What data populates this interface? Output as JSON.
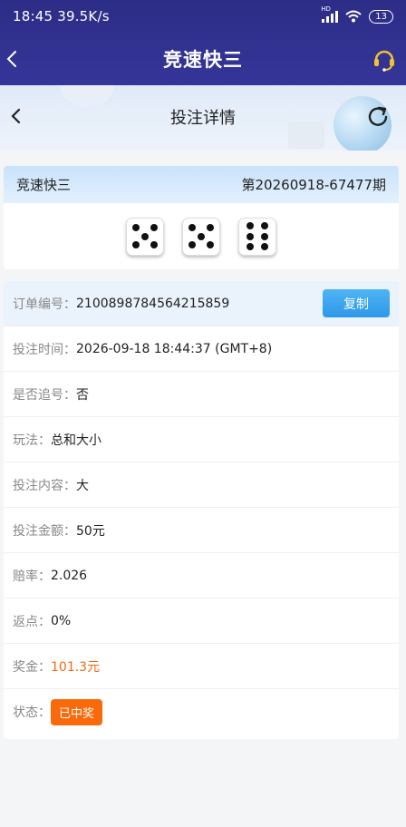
{
  "status_bar": {
    "time": "18:45",
    "speed": "39.5K/s",
    "network": "HD",
    "battery": "13"
  },
  "nav": {
    "title": "竞速快三",
    "back_icon": "chevron-left-icon",
    "service_icon": "headset-icon"
  },
  "sub_header": {
    "title": "投注详情",
    "back_icon": "chevron-left-icon",
    "refresh_icon": "refresh-icon"
  },
  "game": {
    "name": "竞速快三",
    "issue": "第20260918-67477期",
    "dice": [
      5,
      5,
      6
    ]
  },
  "details": {
    "order_label": "订单编号：",
    "order_value": "2100898784564215859",
    "copy_label": "复制",
    "time_label": "投注时间：",
    "time_value": "2026-09-18 18:44:37 (GMT+8)",
    "chase_label": "是否追号：",
    "chase_value": "否",
    "play_label": "玩法：",
    "play_value": "总和大小",
    "content_label": "投注内容：",
    "content_value": "大",
    "amount_label": "投注金额：",
    "amount_value": "50元",
    "odds_label": "赔率：",
    "odds_value": "2.026",
    "rebate_label": "返点：",
    "rebate_value": "0%",
    "prize_label": "奖金：",
    "prize_value": "101.3元",
    "status_label": "状态：",
    "status_value": "已中奖"
  },
  "colors": {
    "header_bg": "#2c2d86",
    "accent_blue": "#2e98e8",
    "prize_orange": "#ef6a10",
    "badge_orange": "#fb6a0a"
  }
}
